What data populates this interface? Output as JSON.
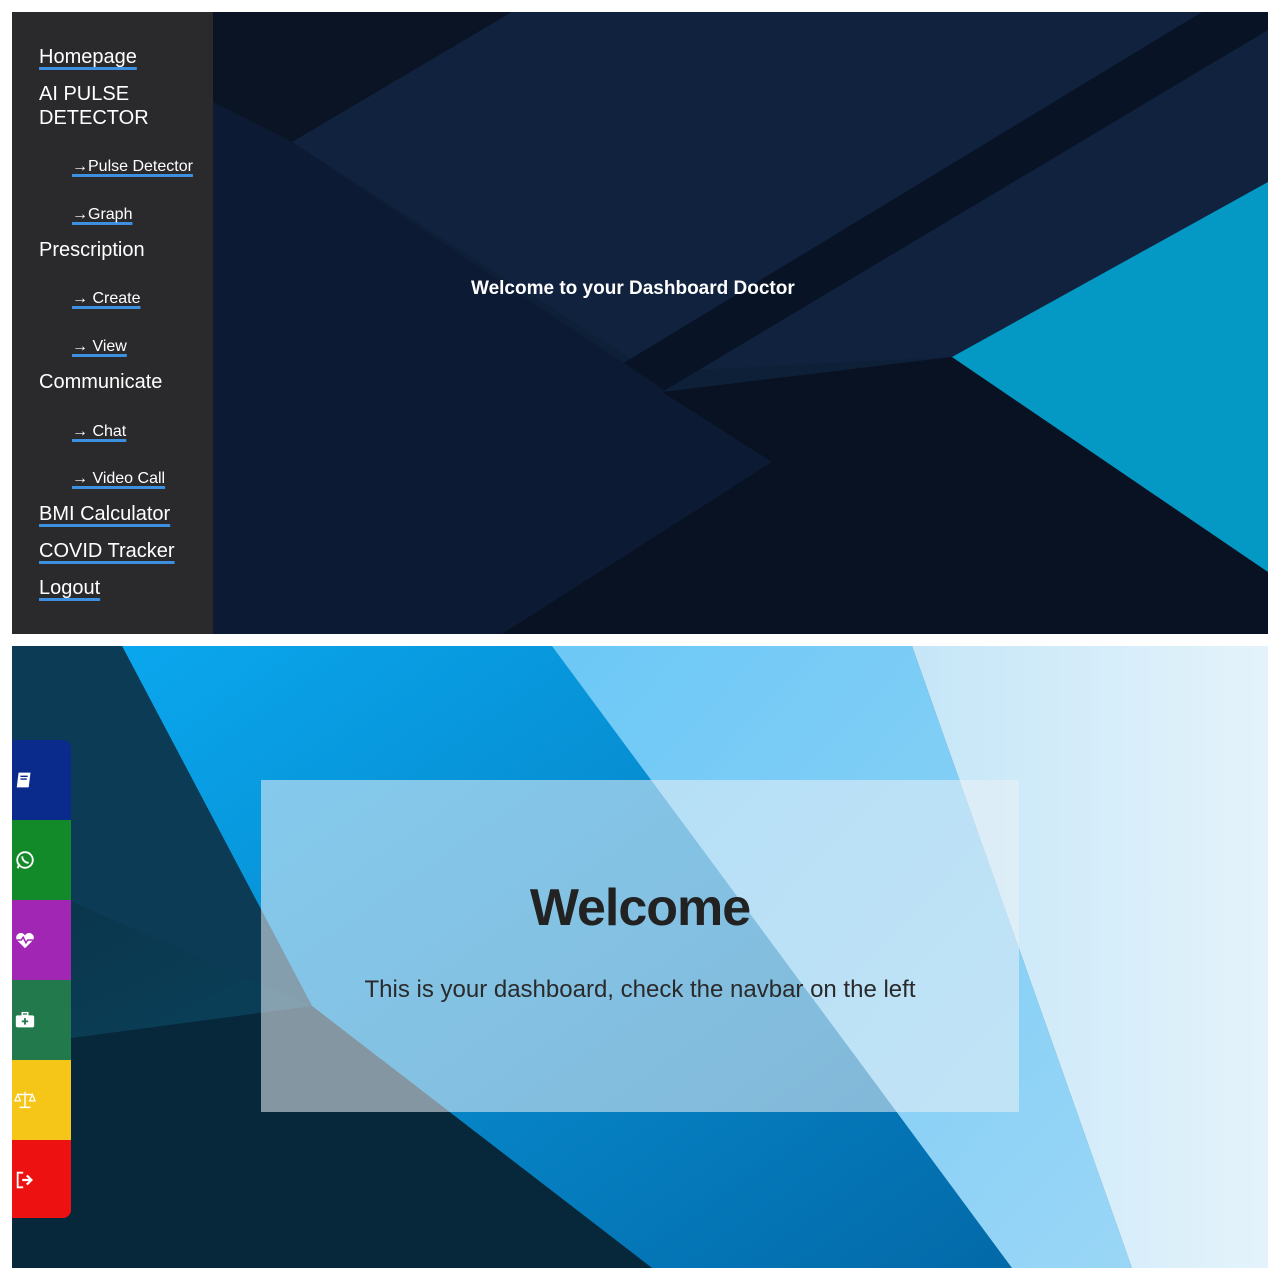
{
  "doctor_dashboard": {
    "nav": {
      "homepage": "Homepage",
      "ai_pulse_detector": "AI PULSE DETECTOR",
      "pulse_detector": "→Pulse Detector",
      "graph": "→Graph",
      "prescription": "Prescription",
      "create": "→ Create",
      "view": "→ View",
      "communicate": "Communicate",
      "chat": "→ Chat",
      "video_call": "→ Video Call",
      "bmi_calculator": "BMI Calculator",
      "covid_tracker": "COVID Tracker",
      "logout": "Logout"
    },
    "welcome_text": "Welcome to your Dashboard Doctor"
  },
  "patient_dashboard": {
    "icon_nav": [
      {
        "icon": "book-icon",
        "color": "#0a2a8c"
      },
      {
        "icon": "whatsapp-icon",
        "color": "#138a2a"
      },
      {
        "icon": "heartbeat-icon",
        "color": "#a126b4"
      },
      {
        "icon": "first-aid-kit-icon",
        "color": "#227a4c"
      },
      {
        "icon": "scale-icon",
        "color": "#f5c518"
      },
      {
        "icon": "sign-out-icon",
        "color": "#ee1111"
      }
    ],
    "card": {
      "title": "Welcome",
      "subtitle": "This is your dashboard, check the navbar on the left"
    }
  }
}
